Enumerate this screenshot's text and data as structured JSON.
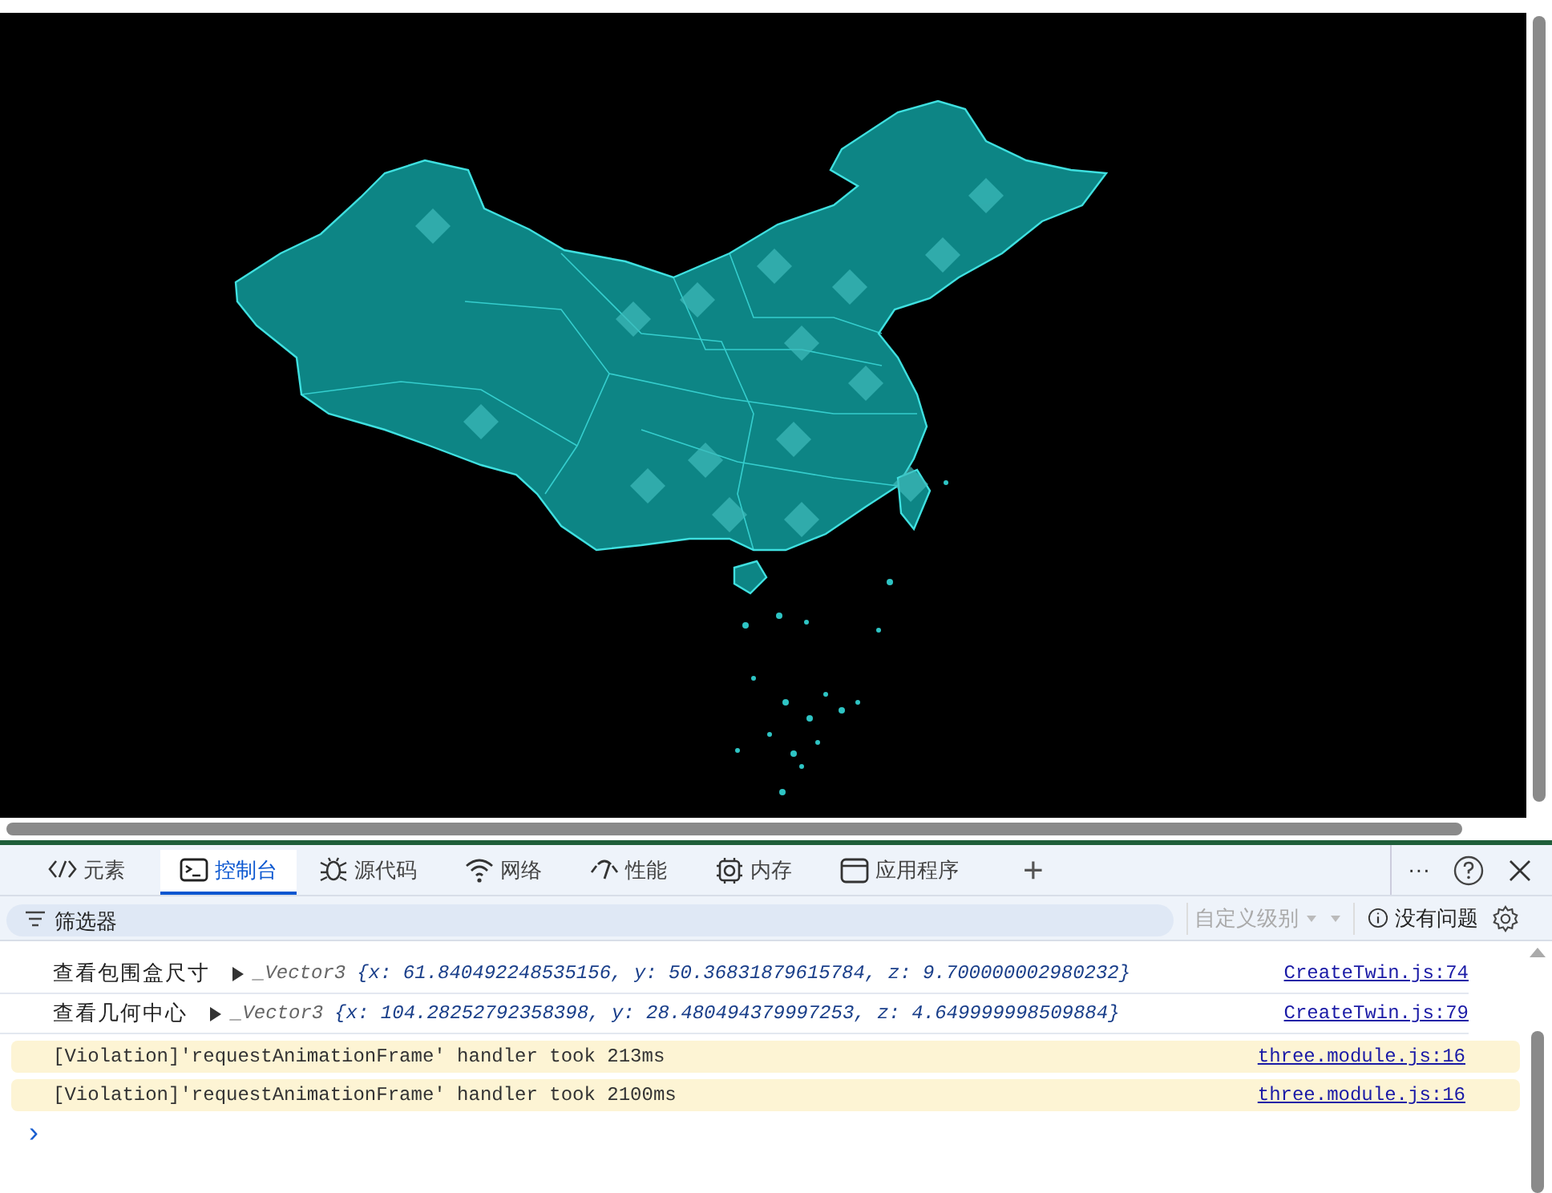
{
  "tabs": [
    {
      "label": "元素",
      "kind": "code",
      "selected": false
    },
    {
      "label": "控制台",
      "kind": "console",
      "selected": true
    },
    {
      "label": "源代码",
      "kind": "bug",
      "selected": false
    },
    {
      "label": "网络",
      "kind": "wifi",
      "selected": false
    },
    {
      "label": "性能",
      "kind": "gauge",
      "selected": false
    },
    {
      "label": "内存",
      "kind": "chip",
      "selected": false
    },
    {
      "label": "应用程序",
      "kind": "window",
      "selected": false
    }
  ],
  "add_tab": "+",
  "toolbar": {
    "more": "···",
    "filter_placeholder": "筛选器",
    "levels": "自定义级别",
    "issues": "没有问题"
  },
  "console": [
    {
      "kind": "log",
      "label": "查看包围盒尺寸",
      "preview": "_Vector3",
      "value": "{x: 61.840492248535156, y: 50.36831879615784, z: 9.700000002980232}",
      "source": "CreateTwin.js:74"
    },
    {
      "kind": "log",
      "label": "查看几何中心",
      "preview": "_Vector3",
      "value": "{x: 104.28252792358398, y: 28.480494379997253, z: 4.649999998509884}",
      "source": "CreateTwin.js:79"
    },
    {
      "kind": "violation",
      "message": "[Violation]'requestAnimationFrame' handler took 213ms",
      "source": "three.module.js:16"
    },
    {
      "kind": "violation",
      "message": "[Violation]'requestAnimationFrame' handler took 2100ms",
      "source": "three.module.js:16"
    }
  ],
  "prompt": "›"
}
